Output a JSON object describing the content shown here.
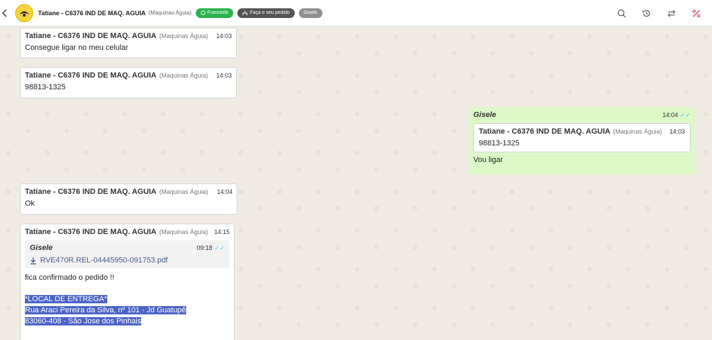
{
  "header": {
    "back_icon": "chevron-left-icon",
    "title": "Tatiane - C6376 IND DE MAQ. AGUIA",
    "subtitle": "(Maquinas Aguia)",
    "tags": [
      {
        "label": "Francielle",
        "color": "#2bb24c",
        "icon": "whatsapp-icon"
      },
      {
        "label": "Faça o seu pedido",
        "color": "#555555",
        "icon": "flow-icon"
      },
      {
        "label": "Gisele",
        "color": "#8f8f8f"
      }
    ],
    "actions": [
      "search-icon",
      "history-icon",
      "transfer-icon",
      "close-ticket-icon"
    ]
  },
  "messages": [
    {
      "sender": "Tatiane - C6376 IND DE MAQ. AGUIA",
      "org": "(Maquinas Águia)",
      "time": "14:03",
      "text": "Consegue ligar no meu celular"
    },
    {
      "sender": "Tatiane - C6376 IND DE MAQ. AGUIA",
      "org": "(Maquinas Águia)",
      "time": "14:03",
      "text": "98813-1325"
    },
    {
      "sender": "Gisele",
      "time": "14:04",
      "quote": {
        "sender": "Tatiane - C6376 IND DE MAQ. AGUIA",
        "org": "(Maquinas Águia)",
        "time": "14:03",
        "text": "98813-1325"
      },
      "text": "Vou ligar"
    },
    {
      "sender": "Tatiane - C6376 IND DE MAQ. AGUIA",
      "org": "(Maquinas Águia)",
      "time": "14:04",
      "text": "Ok"
    },
    {
      "sender": "Tatiane - C6376 IND DE MAQ. AGUIA",
      "org": "(Maquinas Águia)",
      "time": "14:15",
      "quote": {
        "sender": "Gisele",
        "time": "09:18",
        "file": "RVE470R.REL-04445950-091753.pdf"
      },
      "text": "fica confirmado o pedido !!",
      "lines": [
        "*LOCAL DE ENTREGA*",
        "Rua Araci Pereira da Silva, nº 101 - Jd Guatupê",
        "83060-408 - São Jose dos Pinhais"
      ]
    }
  ],
  "colors": {
    "outgoing": "#dcf8c6",
    "selection": "#4a63c7",
    "read_ticks": "#4fc3f7"
  }
}
